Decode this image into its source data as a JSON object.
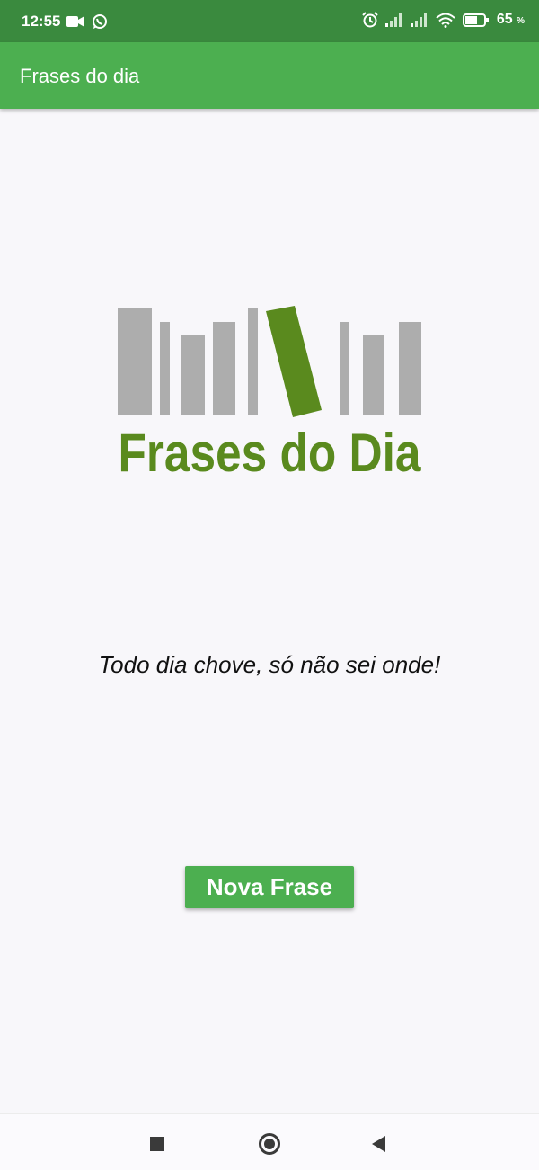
{
  "status_bar": {
    "time": "12:55",
    "left_icons": [
      "video-camera-icon",
      "whatsapp-icon"
    ],
    "right_icons": [
      "alarm-icon",
      "signal-icon",
      "signal-icon",
      "wifi-icon",
      "battery-icon"
    ],
    "battery_percent": "65",
    "battery_unit": "%",
    "battery_level": 0.65
  },
  "app_bar": {
    "title": "Frases do dia"
  },
  "logo": {
    "text": "Frases do Dia",
    "text_color": "#5a8a1e",
    "book_color": "#adadad"
  },
  "main": {
    "phrase": "Todo dia chove, só não sei onde!"
  },
  "actions": {
    "new_phrase_label": "Nova Frase"
  },
  "colors": {
    "primary": "#4caf50",
    "status_bar": "#3a8a3e",
    "background": "#f8f7fa"
  },
  "nav_bar": {
    "buttons": [
      "recents-icon",
      "home-icon",
      "back-icon"
    ]
  }
}
